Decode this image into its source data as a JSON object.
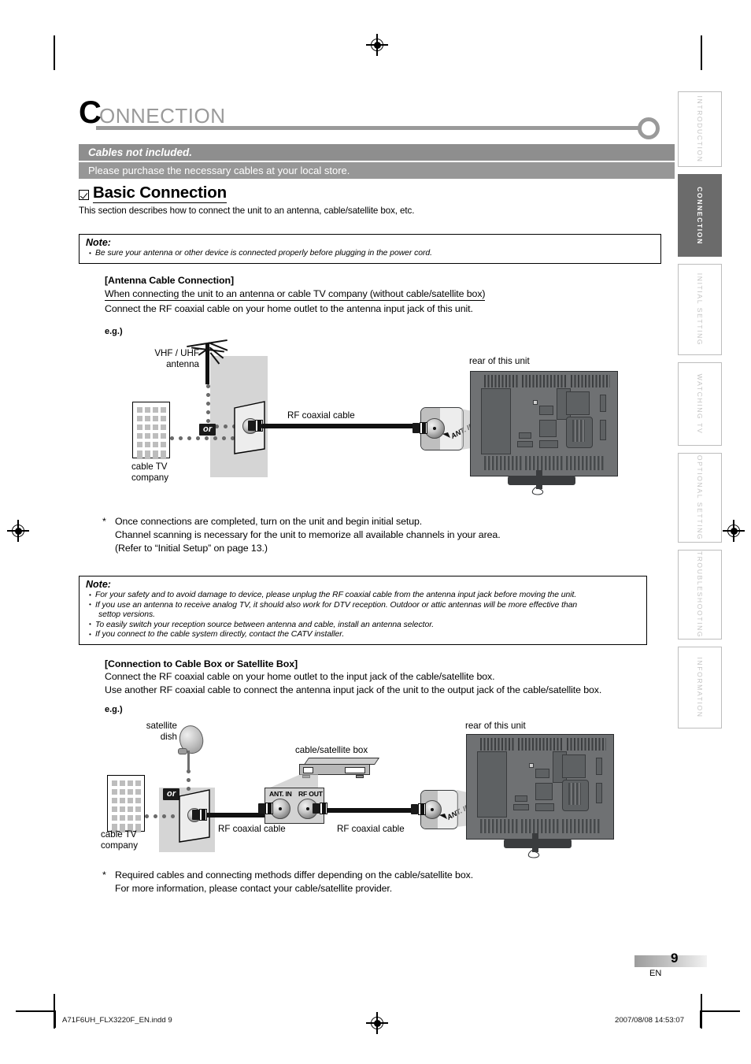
{
  "chapter": {
    "initial": "C",
    "rest": "ONNECTION"
  },
  "banner": {
    "title": "Cables not included.",
    "text": "Please purchase the necessary cables at your local store."
  },
  "section": {
    "title": "Basic Connection",
    "subtitle": "This section describes how to connect the unit to an antenna, cable/satellite box, etc."
  },
  "note1": {
    "title": "Note:",
    "items": [
      "Be sure your antenna or other device is connected properly before plugging in the power cord."
    ]
  },
  "antenna_section": {
    "heading": "[Antenna Cable Connection]",
    "underlined": "When connecting the unit to an antenna or cable TV company (without cable/satellite box)",
    "body": "Connect the RF coaxial cable on your home outlet to the antenna input jack of this unit.",
    "eg": "e.g.)"
  },
  "diagram1": {
    "antenna_label_line1": "VHF / UHF",
    "antenna_label_line2": "antenna",
    "cable_tv_line1": "cable TV",
    "cable_tv_line2": "company",
    "or": "or",
    "coax_label": "RF coaxial cable",
    "rear_label": "rear of this unit",
    "ant_in": "ANT. IN"
  },
  "star1": {
    "mark": "*",
    "line1": "Once connections are completed, turn on the unit and begin initial setup.",
    "line2": "Channel scanning is necessary for the unit to memorize all available channels in your area.",
    "line3": "(Refer to “Initial Setup” on page 13.)"
  },
  "note2": {
    "title": "Note:",
    "items": [
      "For your safety and to avoid damage to device, please unplug the RF coaxial cable from the antenna input jack before moving the unit.",
      "If you use an antenna to receive analog TV, it should also work for DTV reception. Outdoor or attic antennas will be more effective than",
      "settop versions.",
      "To easily switch your reception source between antenna and cable, install an antenna selector.",
      "If you connect to the cable system directly, contact the CATV installer."
    ]
  },
  "cablebox_section": {
    "heading": "[Connection to Cable Box or Satellite Box]",
    "line1": "Connect the RF coaxial cable on your home outlet to the input jack of the cable/satellite box.",
    "line2": "Use another RF coaxial cable to connect the antenna input jack of the unit to the output jack of the cable/satellite box.",
    "eg": "e.g.)"
  },
  "diagram2": {
    "satellite_line1": "satellite",
    "satellite_line2": "dish",
    "cable_tv_line1": "cable TV",
    "cable_tv_line2": "company",
    "or": "or",
    "box_label": "cable/satellite box",
    "jack_ant_in": "ANT. IN",
    "jack_rf_out": "RF OUT",
    "coax_label_left": "RF coaxial cable",
    "coax_label_right": "RF coaxial cable",
    "rear_label": "rear of this unit",
    "ant_in": "ANT. IN"
  },
  "star2": {
    "mark": "*",
    "line1": "Required cables and connecting methods differ depending on the cable/satellite box.",
    "line2": "For more information, please contact your cable/satellite provider."
  },
  "side_tabs": [
    {
      "label": "INTRODUCTION",
      "active": false
    },
    {
      "label": "CONNECTION",
      "active": true
    },
    {
      "label": "INITIAL  SETTING",
      "active": false
    },
    {
      "label": "WATCHING  TV",
      "active": false
    },
    {
      "label": "OPTIONAL  SETTING",
      "active": false
    },
    {
      "label": "TROUBLESHOOTING",
      "active": false
    },
    {
      "label": "INFORMATION",
      "active": false
    }
  ],
  "page": {
    "number": "9",
    "lang": "EN"
  },
  "footer": {
    "file": "A71F6UH_FLX3220F_EN.indd   9",
    "timestamp": "2007/08/08   14:53:07"
  }
}
